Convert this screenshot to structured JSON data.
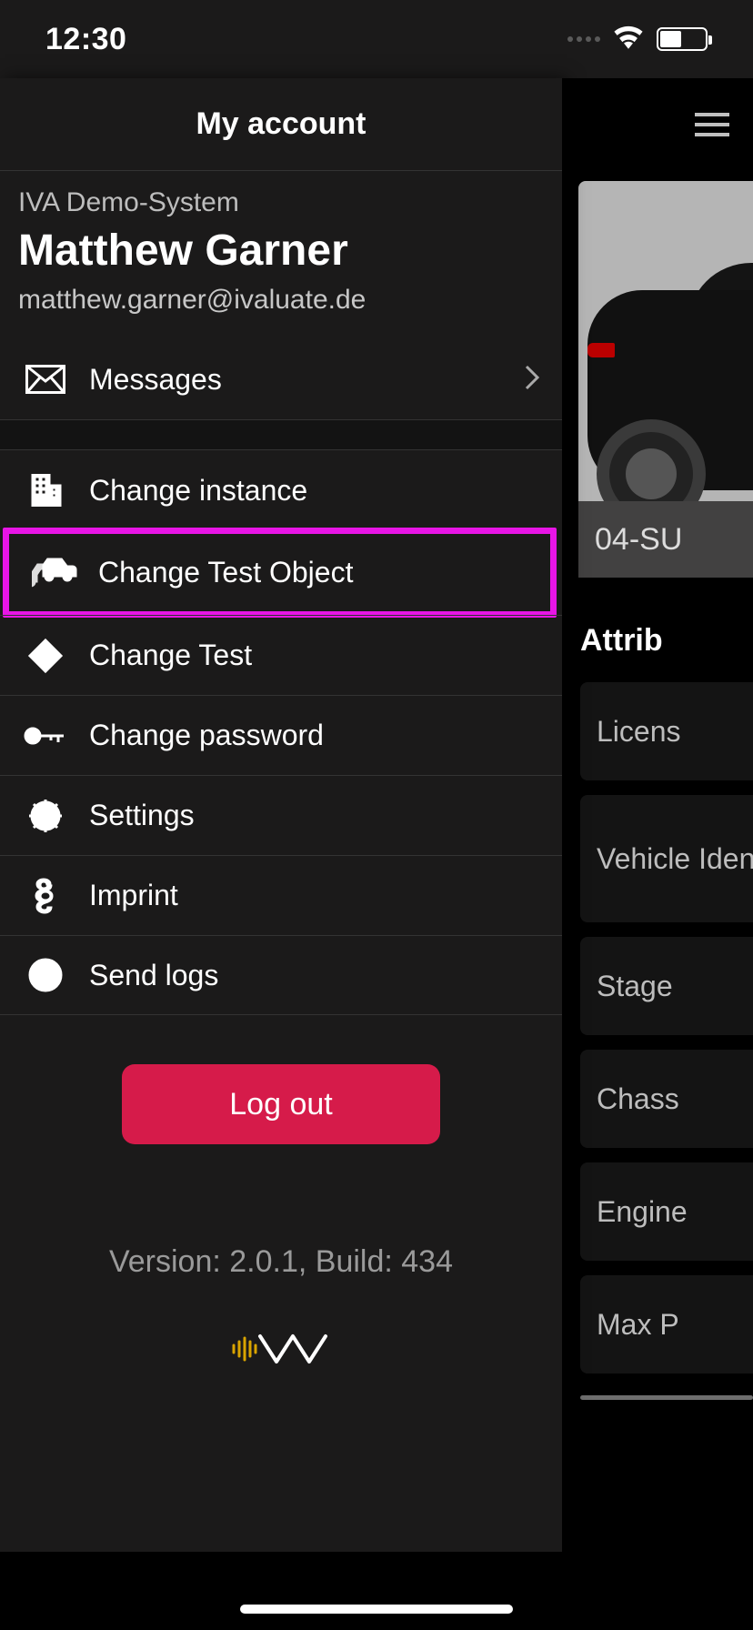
{
  "status": {
    "time": "12:30"
  },
  "panel": {
    "title": "My account",
    "system": "IVA Demo-System",
    "user_name": "Matthew Garner",
    "user_email": "matthew.garner@ivaluate.de",
    "messages_label": "Messages",
    "items": [
      {
        "label": "Change instance"
      },
      {
        "label": "Change Test Object"
      },
      {
        "label": "Change Test"
      },
      {
        "label": "Change password"
      },
      {
        "label": "Settings"
      },
      {
        "label": "Imprint"
      },
      {
        "label": "Send logs"
      }
    ],
    "logout_label": "Log out",
    "version": "Version: 2.0.1, Build: 434"
  },
  "background": {
    "card_label": "04-SU",
    "section_title": "Attrib",
    "attributes": [
      "Licens",
      "Vehicle Identification\nNumber",
      "Stage",
      "Chass",
      "Engine",
      "Max P"
    ]
  }
}
